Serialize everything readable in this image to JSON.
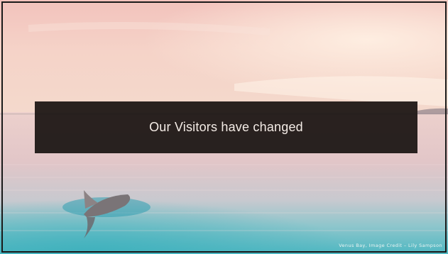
{
  "slide": {
    "title": "Our Visitors have changed",
    "caption": "Venus Bay, Image Credit – Lily Sampson"
  },
  "colors": {
    "sky_top": "#f3c8c0",
    "sky_mid": "#f6d6c9",
    "horizon": "#f1d3c6",
    "water_far": "#e6c7c6",
    "water_near": "#6fc0c6",
    "band": "#181210",
    "title_text": "#f4ece6"
  },
  "icons": {
    "dolphin": "dolphin-fin-icon"
  }
}
